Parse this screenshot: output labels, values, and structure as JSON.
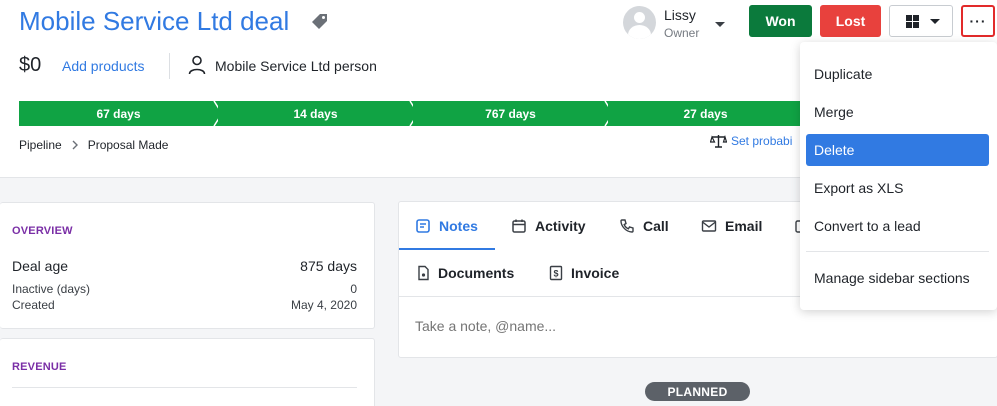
{
  "deal": {
    "title": "Mobile Service Ltd deal",
    "value": "$0",
    "add_products_label": "Add products",
    "person": "Mobile Service Ltd person"
  },
  "owner": {
    "name": "Lissy",
    "role": "Owner"
  },
  "actions": {
    "won_label": "Won",
    "lost_label": "Lost",
    "more_label": "···"
  },
  "pipeline": {
    "stages": [
      {
        "label": "67 days"
      },
      {
        "label": "14 days"
      },
      {
        "label": "767 days"
      },
      {
        "label": "27 days"
      }
    ],
    "breadcrumb": {
      "root": "Pipeline",
      "stage": "Proposal Made"
    },
    "set_probability_label": "Set probabi"
  },
  "overview": {
    "heading": "OVERVIEW",
    "deal_age_label": "Deal age",
    "deal_age_value": "875 days",
    "inactive_label": "Inactive (days)",
    "inactive_value": "0",
    "created_label": "Created",
    "created_value": "May 4, 2020"
  },
  "revenue": {
    "heading": "REVENUE"
  },
  "tabs": {
    "notes": "Notes",
    "activity": "Activity",
    "call": "Call",
    "email": "Email",
    "documents": "Documents",
    "invoice": "Invoice",
    "note_placeholder": "Take a note, @name..."
  },
  "timeline": {
    "planned_label": "PLANNED"
  },
  "menu": {
    "items": [
      {
        "label": "Duplicate"
      },
      {
        "label": "Merge"
      },
      {
        "label": "Delete"
      },
      {
        "label": "Export as XLS"
      },
      {
        "label": "Convert to a lead"
      },
      {
        "label": "Manage sidebar sections"
      }
    ],
    "active_index": 2
  },
  "colors": {
    "accent": "#317ae2",
    "won": "#0b7a3c",
    "lost": "#e8413d",
    "stage": "#10a344",
    "section_heading": "#7a2ea6"
  }
}
